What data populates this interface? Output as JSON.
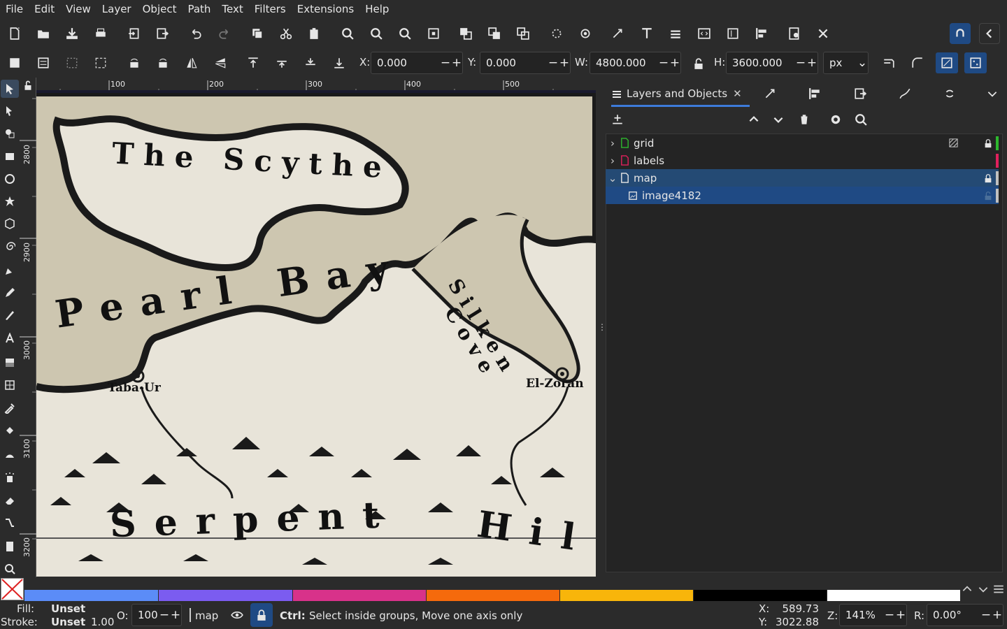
{
  "menu": [
    "File",
    "Edit",
    "View",
    "Layer",
    "Object",
    "Path",
    "Text",
    "Filters",
    "Extensions",
    "Help"
  ],
  "controls": {
    "x_label": "X:",
    "x_value": "0.000",
    "y_label": "Y:",
    "y_value": "0.000",
    "w_label": "W:",
    "w_value": "4800.000",
    "h_label": "H:",
    "h_value": "3600.000",
    "unit": "px"
  },
  "ruler": {
    "h_ticks": [
      "100",
      "200",
      "300",
      "400",
      "500"
    ],
    "v_ticks": [
      "2800",
      "2900",
      "3000",
      "3100",
      "3200"
    ]
  },
  "map_labels": {
    "scythe": "The Scythe",
    "pearl": "Pearl Bay",
    "silken": "Silken",
    "cove": "Cove",
    "taba": "Taba-Ur",
    "zoran": "El-Zoran",
    "serpent": "Serpent",
    "hil": "Hil"
  },
  "panel": {
    "tab_title": "Layers and Objects",
    "layers": [
      {
        "name": "grid",
        "color": "#2eb82e",
        "expanded": false,
        "locked": true
      },
      {
        "name": "labels",
        "color": "#e0205c",
        "expanded": false,
        "locked": false
      },
      {
        "name": "map",
        "color": "#c0c0c0",
        "expanded": true,
        "locked": true
      },
      {
        "name": "image4182",
        "color": "#c0c0c0",
        "child": true,
        "selected": true
      }
    ]
  },
  "palette_colors": [
    "#5b8cf7",
    "#7b5cf0",
    "#d8328a",
    "#f56a0c",
    "#f8b50a",
    "#000000",
    "#ffffff"
  ],
  "status": {
    "fill_label": "Fill:",
    "fill_value": "Unset",
    "stroke_label": "Stroke:",
    "stroke_value": "Unset",
    "stroke_width": "1.00",
    "opacity_label": "O:",
    "opacity_value": "100",
    "layer_name": "map",
    "hint_key": "Ctrl:",
    "hint_text": "Select inside groups, Move one axis only",
    "x_label": "X:",
    "x_value": "589.73",
    "y_label": "Y:",
    "y_value": "3022.88",
    "zoom_label": "Z:",
    "zoom_value": "141%",
    "rot_label": "R:",
    "rot_value": "0.00°"
  }
}
